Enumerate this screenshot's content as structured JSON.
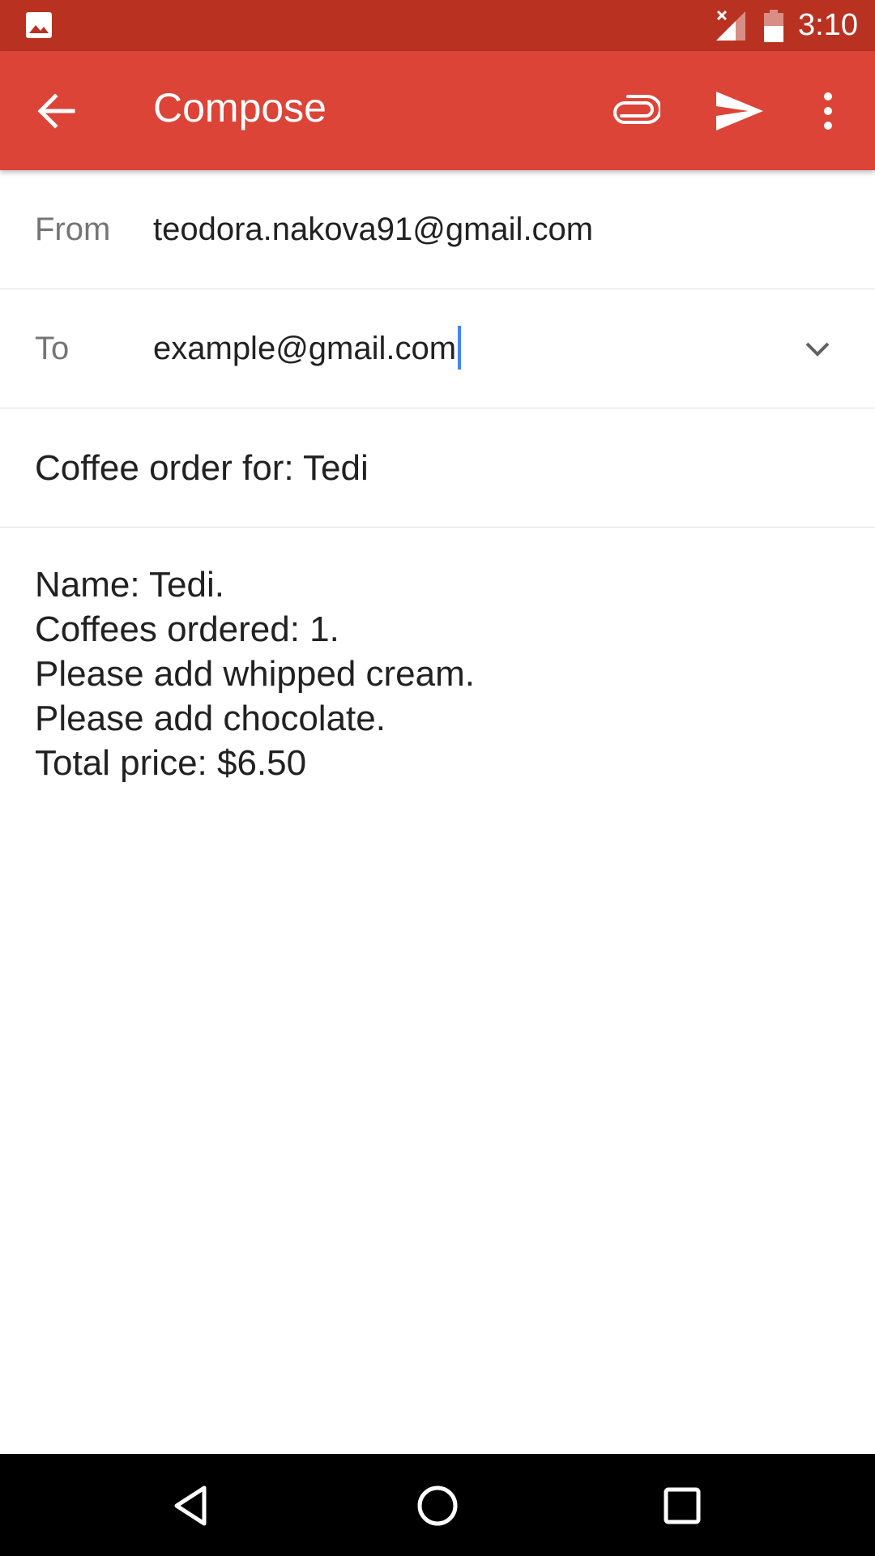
{
  "status_bar": {
    "time": "3:10",
    "icons": [
      "gallery-icon",
      "signal-off-icon",
      "battery-icon"
    ]
  },
  "app_bar": {
    "title": "Compose",
    "color": "#db4437",
    "icons": [
      "back-arrow-icon",
      "paperclip-icon",
      "send-icon",
      "more-vert-icon"
    ]
  },
  "from": {
    "label": "From",
    "value": "teodora.nakova91@gmail.com"
  },
  "to": {
    "label": "To",
    "value": "example@gmail.com"
  },
  "subject": {
    "value": "Coffee order for: Tedi"
  },
  "body": {
    "lines": [
      "Name: Tedi.",
      "Coffees ordered: 1.",
      "Please add whipped cream.",
      "Please add chocolate.",
      "Total price: $6.50"
    ]
  },
  "nav_bar": {
    "icons": [
      "nav-back-icon",
      "nav-home-icon",
      "nav-recents-icon"
    ]
  }
}
